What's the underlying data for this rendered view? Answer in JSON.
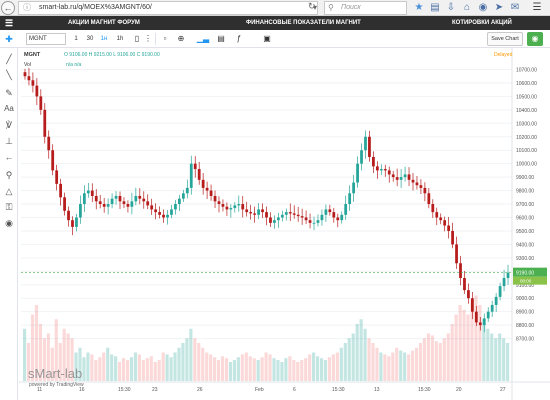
{
  "browser": {
    "url": "smart-lab.ru/q/MOEX%3AMGNT/60/",
    "search_placeholder": "Поиск"
  },
  "site_nav": {
    "links": [
      "АКЦИИ МАГНИТ ФОРУМ",
      "ФИНАНСОВЫЕ ПОКАЗАТЕЛИ МАГНИТ",
      "КОТИРОВКИ АКЦИЙ"
    ]
  },
  "toolbar": {
    "symbol": "MGNT",
    "intervals": [
      "1",
      "30",
      "1н",
      "1h"
    ],
    "save_label": "Save Chart"
  },
  "legend": {
    "symbol": "MGNT",
    "ohlc": "O 9106.00 H 9215.00 L 9106.00 C 9190.00",
    "vol_label": "Vol",
    "vol_values": "n/a n/a",
    "market_status": "Delayed"
  },
  "watermark": {
    "brand": "sMart-lab",
    "powered": "powered by TradingView"
  },
  "icons": {
    "back": "arrow-left-icon",
    "lock": "lock-icon",
    "reload": "reload-icon",
    "search": "search-icon",
    "star": "star-icon",
    "menu": "hamburger-icon",
    "camera": "camera-icon"
  },
  "colors": {
    "up": "#26a69a",
    "down": "#b71c1c",
    "volume": "rgba(38,166,154,0.35)",
    "price_tag": "#4caf50",
    "nav_bg": "#2f2f2f"
  },
  "chart_data": {
    "type": "candlestick",
    "ylim": [
      8630,
      10830
    ],
    "y_ticks": [
      10700,
      10600,
      10500,
      10400,
      10300,
      10200,
      10100,
      10000,
      9900,
      9800,
      9700,
      9600,
      9500,
      9400,
      9300,
      9200,
      9100,
      9000,
      8900,
      8800,
      8700
    ],
    "x_tick_labels": [
      "11",
      "16",
      "15:30",
      "23",
      "26",
      "Feb",
      "6",
      "15:30",
      "13",
      "15:30",
      "20",
      "27"
    ],
    "last_price": "9190.00",
    "last_price_sub": "00:00",
    "closes": [
      10650,
      10620,
      10580,
      10500,
      10400,
      10200,
      10100,
      9950,
      9850,
      9750,
      9650,
      9580,
      9530,
      9600,
      9700,
      9780,
      9800,
      9760,
      9720,
      9700,
      9680,
      9700,
      9740,
      9760,
      9720,
      9700,
      9680,
      9720,
      9760,
      9740,
      9720,
      9690,
      9660,
      9640,
      9620,
      9600,
      9620,
      9660,
      9700,
      9740,
      9780,
      9820,
      10000,
      9960,
      9880,
      9820,
      9800,
      9760,
      9720,
      9700,
      9680,
      9660,
      9670,
      9690,
      9700,
      9660,
      9640,
      9630,
      9620,
      9660,
      9640,
      9600,
      9560,
      9580,
      9600,
      9620,
      9640,
      9630,
      9620,
      9610,
      9600,
      9580,
      9560,
      9560,
      9580,
      9620,
      9660,
      9640,
      9600,
      9580,
      9620,
      9700,
      9780,
      9860,
      10000,
      10100,
      10200,
      10050,
      9980,
      9950,
      9960,
      9950,
      9920,
      9900,
      9880,
      9900,
      9920,
      9880,
      9860,
      9840,
      9820,
      9780,
      9700,
      9640,
      9600,
      9580,
      9540,
      9500,
      9400,
      9260,
      9150,
      9060,
      9000,
      8900,
      8820,
      8800,
      8850,
      8900,
      8950,
      9010,
      9090,
      9150,
      9190
    ],
    "volumes": [
      0.55,
      0.4,
      0.7,
      0.8,
      0.6,
      0.45,
      0.5,
      0.35,
      0.65,
      0.4,
      0.55,
      0.5,
      0.45,
      0.3,
      0.35,
      0.25,
      0.3,
      0.28,
      0.22,
      0.25,
      0.3,
      0.35,
      0.28,
      0.26,
      0.2,
      0.24,
      0.22,
      0.25,
      0.3,
      0.28,
      0.22,
      0.24,
      0.26,
      0.2,
      0.22,
      0.3,
      0.28,
      0.25,
      0.3,
      0.35,
      0.4,
      0.45,
      0.55,
      0.45,
      0.4,
      0.35,
      0.3,
      0.28,
      0.25,
      0.22,
      0.26,
      0.24,
      0.2,
      0.22,
      0.25,
      0.28,
      0.3,
      0.26,
      0.24,
      0.22,
      0.25,
      0.3,
      0.28,
      0.24,
      0.22,
      0.2,
      0.24,
      0.26,
      0.22,
      0.2,
      0.22,
      0.24,
      0.28,
      0.3,
      0.26,
      0.24,
      0.22,
      0.25,
      0.28,
      0.3,
      0.35,
      0.4,
      0.45,
      0.5,
      0.6,
      0.65,
      0.55,
      0.45,
      0.4,
      0.35,
      0.3,
      0.28,
      0.26,
      0.3,
      0.35,
      0.32,
      0.3,
      0.28,
      0.32,
      0.35,
      0.4,
      0.45,
      0.5,
      0.48,
      0.42,
      0.4,
      0.45,
      0.5,
      0.6,
      0.7,
      0.8,
      0.75,
      0.7,
      0.85,
      0.9,
      0.8,
      0.65,
      0.55,
      0.5,
      0.45,
      0.5,
      0.45,
      0.4
    ]
  }
}
